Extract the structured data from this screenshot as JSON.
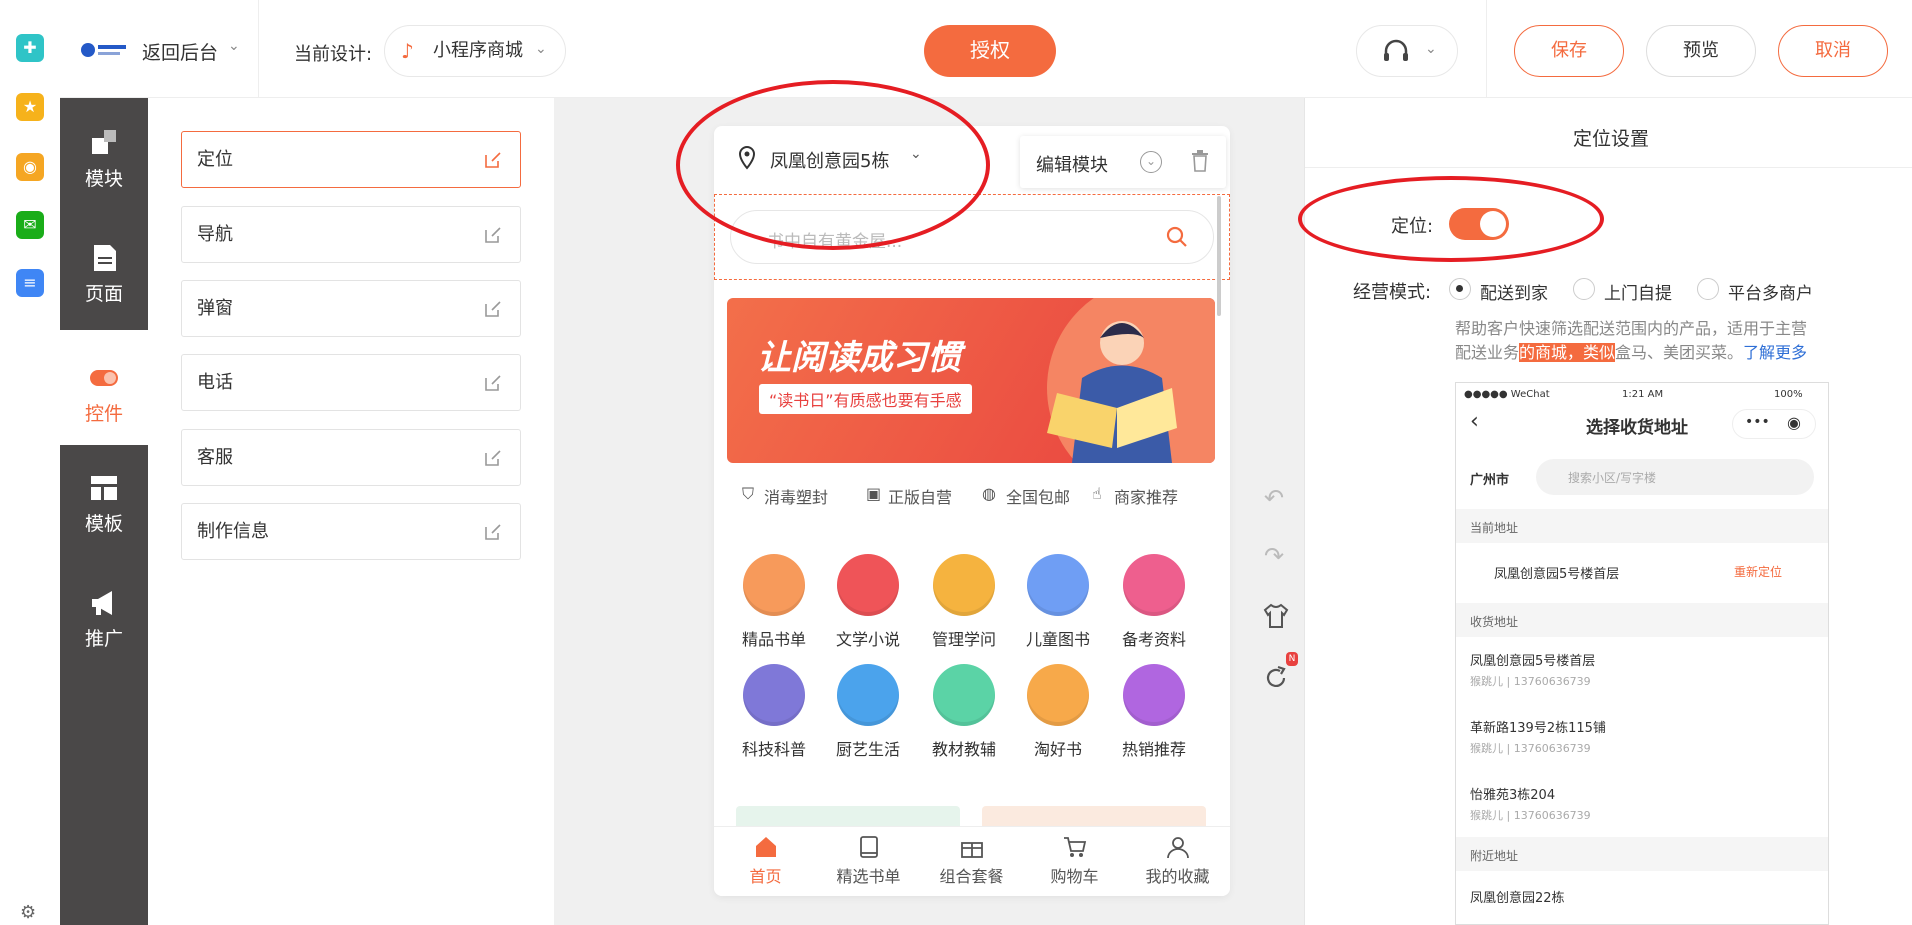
{
  "topbar": {
    "back_label": "返回后台",
    "current_design_label": "当前设计:",
    "design_name": "小程序商城",
    "authorize_label": "授权",
    "save_label": "保存",
    "preview_label": "预览",
    "cancel_label": "取消"
  },
  "sidebar": {
    "items": [
      {
        "label": "模块",
        "icon": "blocks-icon",
        "active": false
      },
      {
        "label": "页面",
        "icon": "page-icon",
        "active": false
      },
      {
        "label": "控件",
        "icon": "toggle-icon",
        "active": true
      },
      {
        "label": "模板",
        "icon": "template-icon",
        "active": false
      },
      {
        "label": "推广",
        "icon": "megaphone-icon",
        "active": false
      }
    ]
  },
  "widgets": {
    "items": [
      {
        "label": "定位",
        "selected": true
      },
      {
        "label": "导航",
        "selected": false
      },
      {
        "label": "弹窗",
        "selected": false
      },
      {
        "label": "电话",
        "selected": false
      },
      {
        "label": "客服",
        "selected": false
      },
      {
        "label": "制作信息",
        "selected": false
      }
    ]
  },
  "phone": {
    "location": "凤凰创意园5栋",
    "edit_module_label": "编辑模块",
    "search_placeholder": "书中自有黄金屋...",
    "banner_title": "让阅读成习惯",
    "banner_subtitle": "“读书日”有质感也要有手感",
    "features": [
      "消毒塑封",
      "正版自营",
      "全国包邮",
      "商家推荐"
    ],
    "categories": [
      {
        "label": "精品书单",
        "color": "#f79a5b"
      },
      {
        "label": "文学小说",
        "color": "#ef5458"
      },
      {
        "label": "管理学问",
        "color": "#f5b33f"
      },
      {
        "label": "儿童图书",
        "color": "#6f9ef4"
      },
      {
        "label": "备考资料",
        "color": "#ee5f8e"
      },
      {
        "label": "科技科普",
        "color": "#7f78d8"
      },
      {
        "label": "厨艺生活",
        "color": "#4ba3ec"
      },
      {
        "label": "教材教辅",
        "color": "#5bd3a6"
      },
      {
        "label": "淘好书",
        "color": "#f7a94a"
      },
      {
        "label": "热销推荐",
        "color": "#b066e0"
      }
    ],
    "tabbar": [
      {
        "label": "首页",
        "active": true
      },
      {
        "label": "精选书单",
        "active": false
      },
      {
        "label": "组合套餐",
        "active": false
      },
      {
        "label": "购物车",
        "active": false
      },
      {
        "label": "我的收藏",
        "active": false
      }
    ]
  },
  "right_panel": {
    "title": "定位设置",
    "location_label": "定位:",
    "location_enabled": true,
    "mode_label": "经营模式:",
    "modes": [
      "配送到家",
      "上门自提",
      "平台多商户"
    ],
    "selected_mode": "配送到家",
    "description_part1": "帮助客户快速筛选配送范围内的产品，适用于主营",
    "description_part2a": "配送业务",
    "description_highlight": "的商城，类似",
    "description_part2b": "盒马、美团买菜。",
    "learn_more": "了解更多"
  },
  "preview": {
    "status_left": "●●●●● WeChat",
    "status_time": "1:21 AM",
    "status_battery": "100%",
    "title": "选择收货地址",
    "city": "广州市",
    "search_placeholder": "搜索小区/写字楼",
    "current_section": "当前地址",
    "current_address": "凤凰创意园5号楼首层",
    "relocate": "重新定位",
    "saved_section": "收货地址",
    "addresses": [
      {
        "name": "凤凰创意园5号楼首层",
        "contact": "猴跳儿 | 13760636739"
      },
      {
        "name": "革新路139号2栋115铺",
        "contact": "猴跳儿 | 13760636739"
      },
      {
        "name": "怡雅苑3栋204",
        "contact": "猴跳儿 | 13760636739"
      }
    ],
    "nearby_section": "附近地址",
    "nearby": [
      "凤凰创意园22栋"
    ]
  },
  "colors": {
    "accent": "#f46b3f",
    "sidebar_bg": "#4a4848",
    "annotation_red": "#e51d23"
  }
}
